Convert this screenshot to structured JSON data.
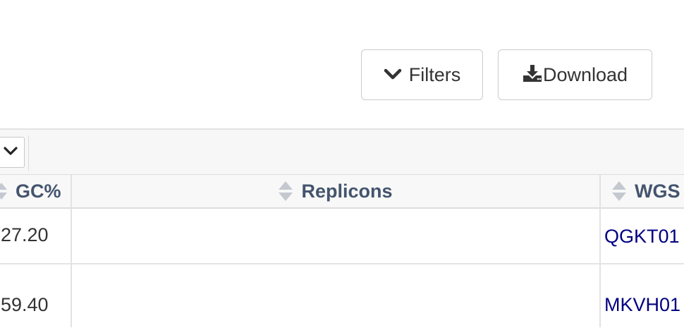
{
  "toolbar": {
    "filters_label": "Filters",
    "download_label": "Download"
  },
  "table": {
    "columns": [
      {
        "label": "GC%",
        "shown": "GC%"
      },
      {
        "label": "Replicons"
      },
      {
        "label": "WGS",
        "shown": "WGS"
      }
    ],
    "rows": [
      {
        "gc": "27.20",
        "replicons": "",
        "wgs": "QGKT01"
      },
      {
        "gc": "59.40",
        "replicons": "",
        "wgs": "MKVH01"
      }
    ]
  },
  "icons": {
    "filters": "chevron-down-icon",
    "download": "download-icon",
    "select": "chevron-down-icon",
    "sort": "sort-icon"
  },
  "colors": {
    "header_text": "#44546e",
    "link_text": "#000080",
    "body_text": "#333333"
  }
}
